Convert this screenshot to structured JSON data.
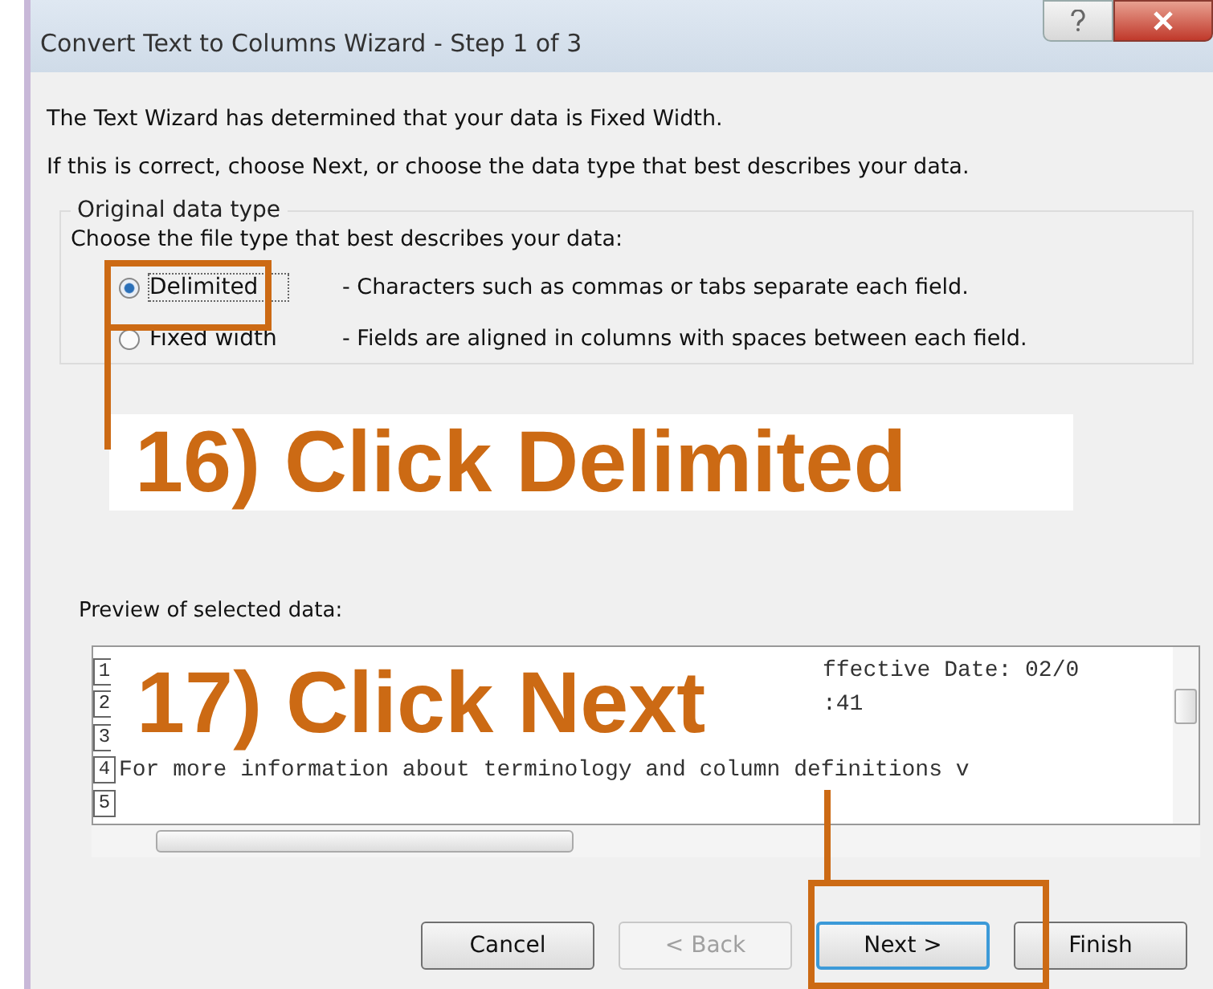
{
  "window": {
    "title": "Convert Text to Columns Wizard - Step 1 of 3"
  },
  "intro": [
    "The Text Wizard has determined that your data is Fixed Width.",
    "If this is correct, choose Next, or choose the data type that best describes your data."
  ],
  "group": {
    "title": "Original data type",
    "prompt": "Choose the file type that best describes your data:",
    "options": [
      {
        "label": "Delimited",
        "description": "- Characters such as commas or tabs separate each field.",
        "selected": true
      },
      {
        "label": "Fixed width",
        "description": "- Fields are aligned in columns with spaces between each field.",
        "selected": false
      }
    ]
  },
  "preview": {
    "label": "Preview of selected data:",
    "rows": [
      {
        "number": "1",
        "text": "ffective Date: 02/0",
        "kind": "covered"
      },
      {
        "number": "2",
        "text": ":41",
        "kind": "covered"
      },
      {
        "number": "3"
      },
      {
        "number": "4",
        "text": "For more information about terminology and column definitions v",
        "kind": "plain"
      },
      {
        "number": "5"
      }
    ]
  },
  "buttons": [
    {
      "label": "Cancel",
      "disabled": false,
      "focused": false
    },
    {
      "label": "< Back",
      "disabled": true,
      "focused": false
    },
    {
      "label": "Next >",
      "disabled": false,
      "focused": true
    },
    {
      "label": "Finish",
      "disabled": false,
      "focused": false
    }
  ],
  "annotations": [
    {
      "text": "16) Click Delimited"
    },
    {
      "text": "17) Click Next"
    }
  ]
}
